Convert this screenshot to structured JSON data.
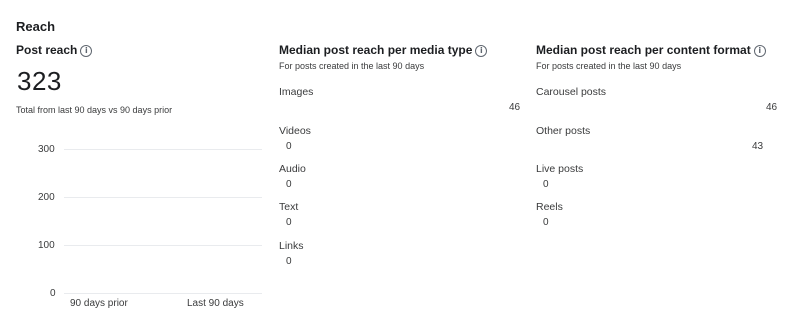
{
  "section_title": "Reach",
  "post_reach": {
    "title": "Post reach",
    "value": "323",
    "caption": "Total from last 90 days vs 90 days prior"
  },
  "chart_data": {
    "type": "bar",
    "categories": [
      "90 days prior",
      "Last 90 days"
    ],
    "values": [
      0,
      0
    ],
    "ylim": [
      0,
      300
    ],
    "yticks": [
      "300",
      "200",
      "100",
      "0"
    ],
    "grid": true
  },
  "media_type": {
    "title": "Median post reach per media type",
    "subtitle": "For posts created in the last 90 days",
    "rows": [
      {
        "label": "Images",
        "value": "46"
      },
      {
        "label": "Videos",
        "value": "0"
      },
      {
        "label": "Audio",
        "value": "0"
      },
      {
        "label": "Text",
        "value": "0"
      },
      {
        "label": "Links",
        "value": "0"
      }
    ]
  },
  "content_format": {
    "title": "Median post reach per content format",
    "subtitle": "For posts created in the last 90 days",
    "rows": [
      {
        "label": "Carousel posts",
        "value": "46"
      },
      {
        "label": "Other posts",
        "value": "43"
      },
      {
        "label": "Live posts",
        "value": "0"
      },
      {
        "label": "Reels",
        "value": "0"
      }
    ]
  },
  "icons": {
    "info": "info-icon"
  }
}
